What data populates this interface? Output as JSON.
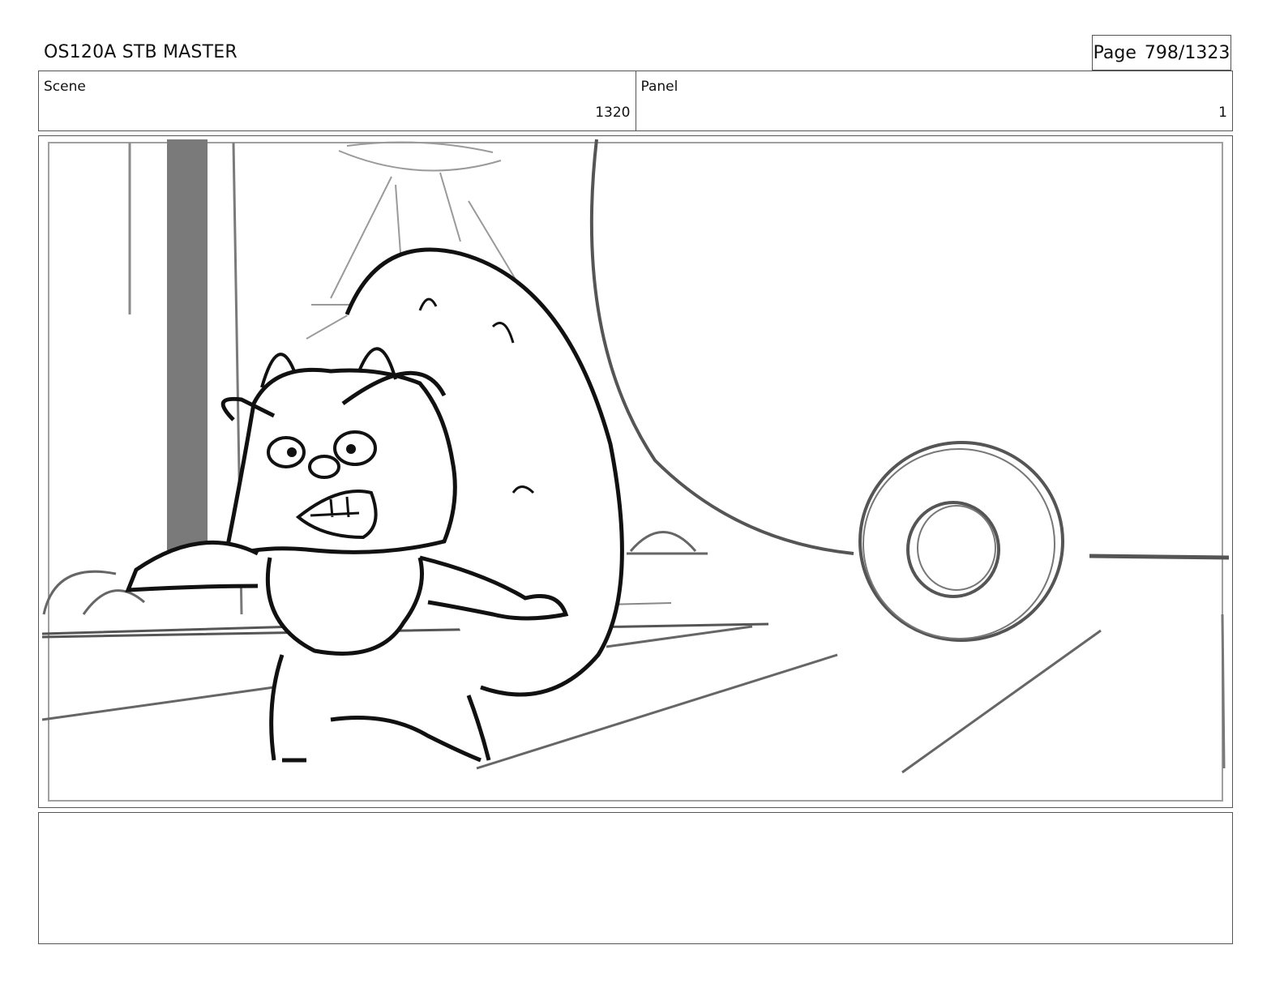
{
  "header": {
    "title": "OS120A STB MASTER",
    "page_label": "Page",
    "page_number": "798/1323"
  },
  "info": {
    "scene_label": "Scene",
    "scene_value": "1320",
    "panel_label": "Panel",
    "panel_value": "1"
  },
  "notes": {
    "text": ""
  }
}
